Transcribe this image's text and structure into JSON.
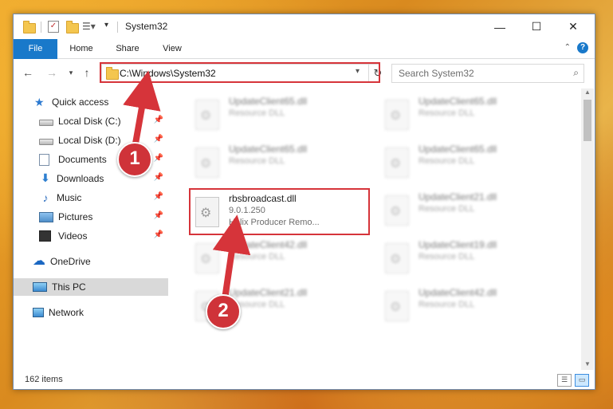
{
  "window": {
    "title": "System32"
  },
  "ribbon": {
    "tabs": [
      "File",
      "Home",
      "Share",
      "View"
    ]
  },
  "address": {
    "path": "C:\\Windows\\System32"
  },
  "search": {
    "placeholder": "Search System32"
  },
  "sidebar": {
    "items": [
      {
        "label": "Quick access",
        "icon": "star-icon"
      },
      {
        "label": "Local Disk (C:)",
        "icon": "disk-icon",
        "pinned": true
      },
      {
        "label": "Local Disk (D:)",
        "icon": "disk-icon",
        "pinned": true
      },
      {
        "label": "Documents",
        "icon": "document-icon",
        "pinned": true
      },
      {
        "label": "Downloads",
        "icon": "download-icon",
        "pinned": true
      },
      {
        "label": "Music",
        "icon": "music-icon",
        "pinned": true
      },
      {
        "label": "Pictures",
        "icon": "pictures-icon",
        "pinned": true
      },
      {
        "label": "Videos",
        "icon": "videos-icon",
        "pinned": true
      },
      {
        "label": "OneDrive",
        "icon": "cloud-icon"
      },
      {
        "label": "This PC",
        "icon": "computer-icon",
        "selected": true
      },
      {
        "label": "Network",
        "icon": "network-icon"
      }
    ]
  },
  "files": {
    "col1": [
      {
        "name": "UpdateClient65.dll",
        "type": "Resource DLL"
      },
      {
        "name": "UpdateClient65.dll",
        "type": "Resource DLL"
      },
      {
        "name": "rbsbroadcast.dll",
        "version": "9.0.1.250",
        "description": "Helix Producer Remo..."
      },
      {
        "name": "UpdateClient42.dll",
        "type": "Resource DLL"
      },
      {
        "name": "UpdateClient21.dll",
        "type": "Resource DLL"
      }
    ],
    "col2": [
      {
        "name": "UpdateClient65.dll",
        "type": "Resource DLL"
      },
      {
        "name": "UpdateClient65.dll",
        "type": "Resource DLL"
      },
      {
        "name": "UpdateClient21.dll",
        "type": "Resource DLL"
      },
      {
        "name": "UpdateClient19.dll",
        "type": "Resource DLL"
      },
      {
        "name": "UpdateClient42.dll",
        "type": "Resource DLL"
      }
    ]
  },
  "status": {
    "item_count": "162 items"
  },
  "annotations": {
    "step1": "1",
    "step2": "2"
  },
  "colors": {
    "accent": "#1979ca",
    "highlight": "#d6343a"
  }
}
